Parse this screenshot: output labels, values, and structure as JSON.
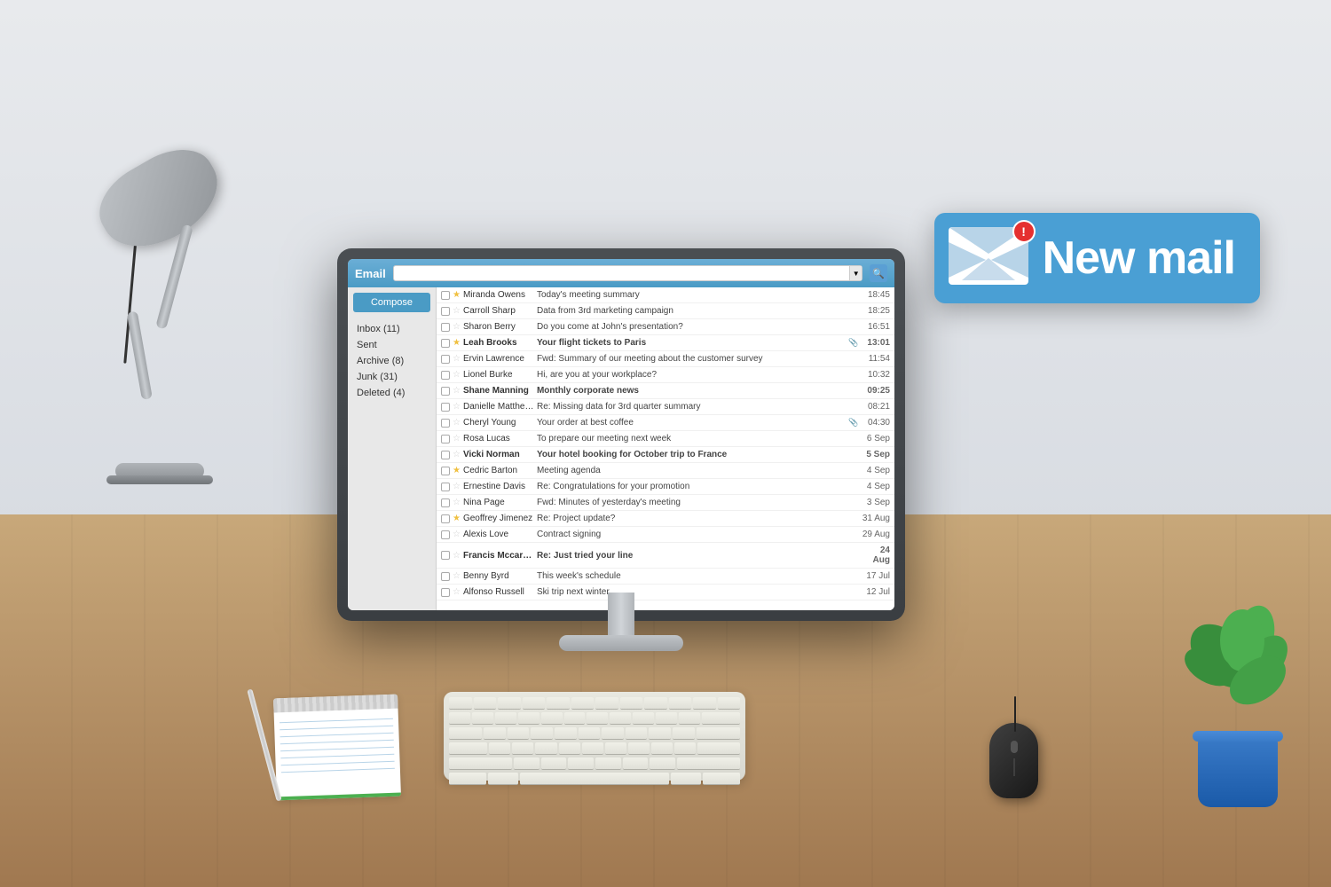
{
  "scene": {
    "background_color": "#dde2e8",
    "desk_color": "#c8a87a"
  },
  "notification": {
    "title": "New mail",
    "badge": "!",
    "background_color": "#4a9fd4"
  },
  "email_app": {
    "title": "Email",
    "search_placeholder": "",
    "compose_label": "Compose",
    "sidebar": [
      {
        "label": "Inbox (11)",
        "active": true
      },
      {
        "label": "Sent"
      },
      {
        "label": "Archive (8)"
      },
      {
        "label": "Junk (31)"
      },
      {
        "label": "Deleted (4)"
      }
    ],
    "emails": [
      {
        "sender": "Miranda Owens",
        "subject": "Today's meeting summary",
        "time": "18:45",
        "starred": true,
        "unread": false,
        "attachment": false
      },
      {
        "sender": "Carroll Sharp",
        "subject": "Data from 3rd marketing campaign",
        "time": "18:25",
        "starred": false,
        "unread": false,
        "attachment": false
      },
      {
        "sender": "Sharon Berry",
        "subject": "Do you come at John's presentation?",
        "time": "16:51",
        "starred": false,
        "unread": false,
        "attachment": false
      },
      {
        "sender": "Leah Brooks",
        "subject": "Your flight tickets to Paris",
        "time": "13:01",
        "starred": true,
        "unread": true,
        "attachment": true
      },
      {
        "sender": "Ervin Lawrence",
        "subject": "Fwd: Summary of our meeting about the customer survey",
        "time": "11:54",
        "starred": false,
        "unread": false,
        "attachment": false
      },
      {
        "sender": "Lionel Burke",
        "subject": "Hi, are you at your workplace?",
        "time": "10:32",
        "starred": false,
        "unread": false,
        "attachment": false
      },
      {
        "sender": "Shane Manning",
        "subject": "Monthly corporate news",
        "time": "09:25",
        "starred": false,
        "unread": true,
        "attachment": false
      },
      {
        "sender": "Danielle Matthews",
        "subject": "Re: Missing data for 3rd quarter summary",
        "time": "08:21",
        "starred": false,
        "unread": false,
        "attachment": false
      },
      {
        "sender": "Cheryl Young",
        "subject": "Your order at best coffee",
        "time": "04:30",
        "starred": false,
        "unread": false,
        "attachment": true
      },
      {
        "sender": "Rosa Lucas",
        "subject": "To prepare our meeting next week",
        "time": "6 Sep",
        "starred": false,
        "unread": false,
        "attachment": false
      },
      {
        "sender": "Vicki Norman",
        "subject": "Your hotel booking for October trip to France",
        "time": "5 Sep",
        "starred": false,
        "unread": true,
        "attachment": false
      },
      {
        "sender": "Cedric Barton",
        "subject": "Meeting agenda",
        "time": "4 Sep",
        "starred": true,
        "unread": false,
        "attachment": false
      },
      {
        "sender": "Ernestine Davis",
        "subject": "Re: Congratulations for your promotion",
        "time": "4 Sep",
        "starred": false,
        "unread": false,
        "attachment": false
      },
      {
        "sender": "Nina Page",
        "subject": "Fwd: Minutes of yesterday's meeting",
        "time": "3 Sep",
        "starred": false,
        "unread": false,
        "attachment": false
      },
      {
        "sender": "Geoffrey Jimenez",
        "subject": "Re: Project update?",
        "time": "31 Aug",
        "starred": true,
        "unread": false,
        "attachment": false
      },
      {
        "sender": "Alexis Love",
        "subject": "Contract signing",
        "time": "29 Aug",
        "starred": false,
        "unread": false,
        "attachment": false
      },
      {
        "sender": "Francis Mccarthy",
        "subject": "Re: Just tried your line",
        "time": "24 Aug",
        "starred": false,
        "unread": true,
        "attachment": false
      },
      {
        "sender": "Benny Byrd",
        "subject": "This week's schedule",
        "time": "17 Jul",
        "starred": false,
        "unread": false,
        "attachment": false
      },
      {
        "sender": "Alfonso Russell",
        "subject": "Ski trip next winter",
        "time": "12 Jul",
        "starred": false,
        "unread": false,
        "attachment": false
      }
    ]
  }
}
